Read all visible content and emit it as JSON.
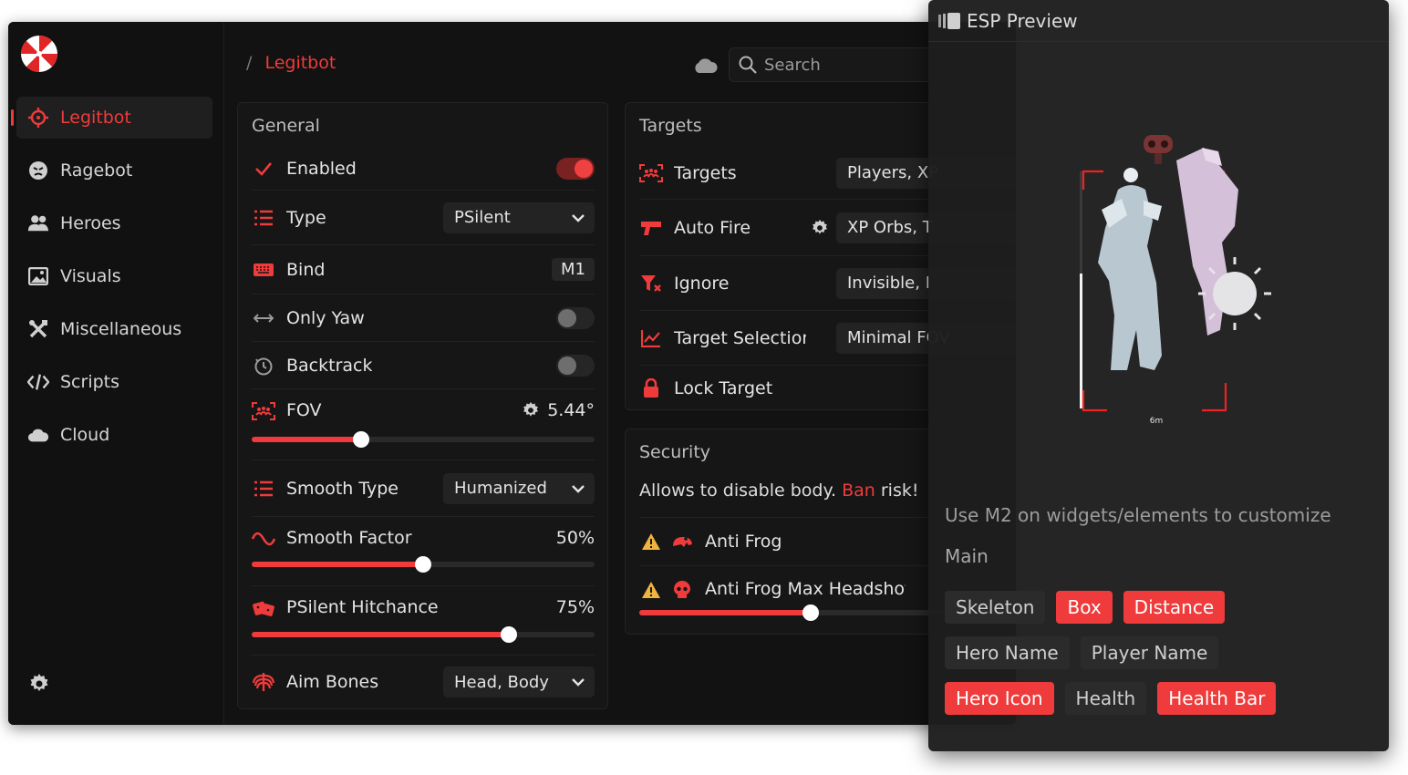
{
  "sidebar": {
    "items": [
      {
        "label": "Legitbot",
        "icon": "crosshair-icon",
        "active": true
      },
      {
        "label": "Ragebot",
        "icon": "angry-face-icon"
      },
      {
        "label": "Heroes",
        "icon": "users-icon"
      },
      {
        "label": "Visuals",
        "icon": "image-icon"
      },
      {
        "label": "Miscellaneous",
        "icon": "tools-icon"
      },
      {
        "label": "Scripts",
        "icon": "code-icon"
      },
      {
        "label": "Cloud",
        "icon": "cloud-icon"
      }
    ]
  },
  "header": {
    "breadcrumb_sep": "/",
    "breadcrumb": "Legitbot",
    "search_placeholder": "Search"
  },
  "general": {
    "title": "General",
    "enabled_label": "Enabled",
    "type_label": "Type",
    "type_value": "PSilent",
    "bind_label": "Bind",
    "bind_value": "M1",
    "only_yaw_label": "Only Yaw",
    "backtrack_label": "Backtrack",
    "fov_label": "FOV",
    "fov_value": "5.44°",
    "fov_fraction": 0.32,
    "smooth_type_label": "Smooth Type",
    "smooth_type_value": "Humanized",
    "smooth_factor_label": "Smooth Factor",
    "smooth_factor_value": "50%",
    "smooth_factor_fraction": 0.5,
    "hitchance_label": "PSilent Hitchance",
    "hitchance_value": "75%",
    "hitchance_fraction": 0.75,
    "aim_bones_label": "Aim Bones",
    "aim_bones_value": "Head, Body"
  },
  "targets": {
    "title": "Targets",
    "targets_label": "Targets",
    "targets_value": "Players, XP",
    "auto_fire_label": "Auto Fire",
    "auto_fire_value": "XP Orbs, T",
    "ignore_label": "Ignore",
    "ignore_value": "Invisible, I",
    "target_selection_label": "Target Selection",
    "target_selection_value": "Minimal FOV",
    "lock_target_label": "Lock Target"
  },
  "security": {
    "title": "Security",
    "note_prefix": "Allows to disable body. ",
    "note_red": "Ban",
    "note_suffix": " risk!",
    "anti_frog_label": "Anti Frog",
    "anti_frog_headshot_label": "Anti Frog Max Headshot",
    "anti_frog_headshot_fraction": 0.5
  },
  "esp": {
    "title": "ESP Preview",
    "distance_label": "6m",
    "hint": "Use M2 on widgets/elements to customize",
    "section": "Main",
    "tags": [
      [
        {
          "label": "Skeleton",
          "on": false
        },
        {
          "label": "Box",
          "on": true
        },
        {
          "label": "Distance",
          "on": true
        }
      ],
      [
        {
          "label": "Hero Name",
          "on": false
        },
        {
          "label": "Player Name",
          "on": false
        }
      ],
      [
        {
          "label": "Hero Icon",
          "on": true
        },
        {
          "label": "Health",
          "on": false
        },
        {
          "label": "Health Bar",
          "on": true
        }
      ]
    ]
  },
  "colors": {
    "accent": "#ef3b3b",
    "background": "#121212",
    "panel": "#161616"
  }
}
